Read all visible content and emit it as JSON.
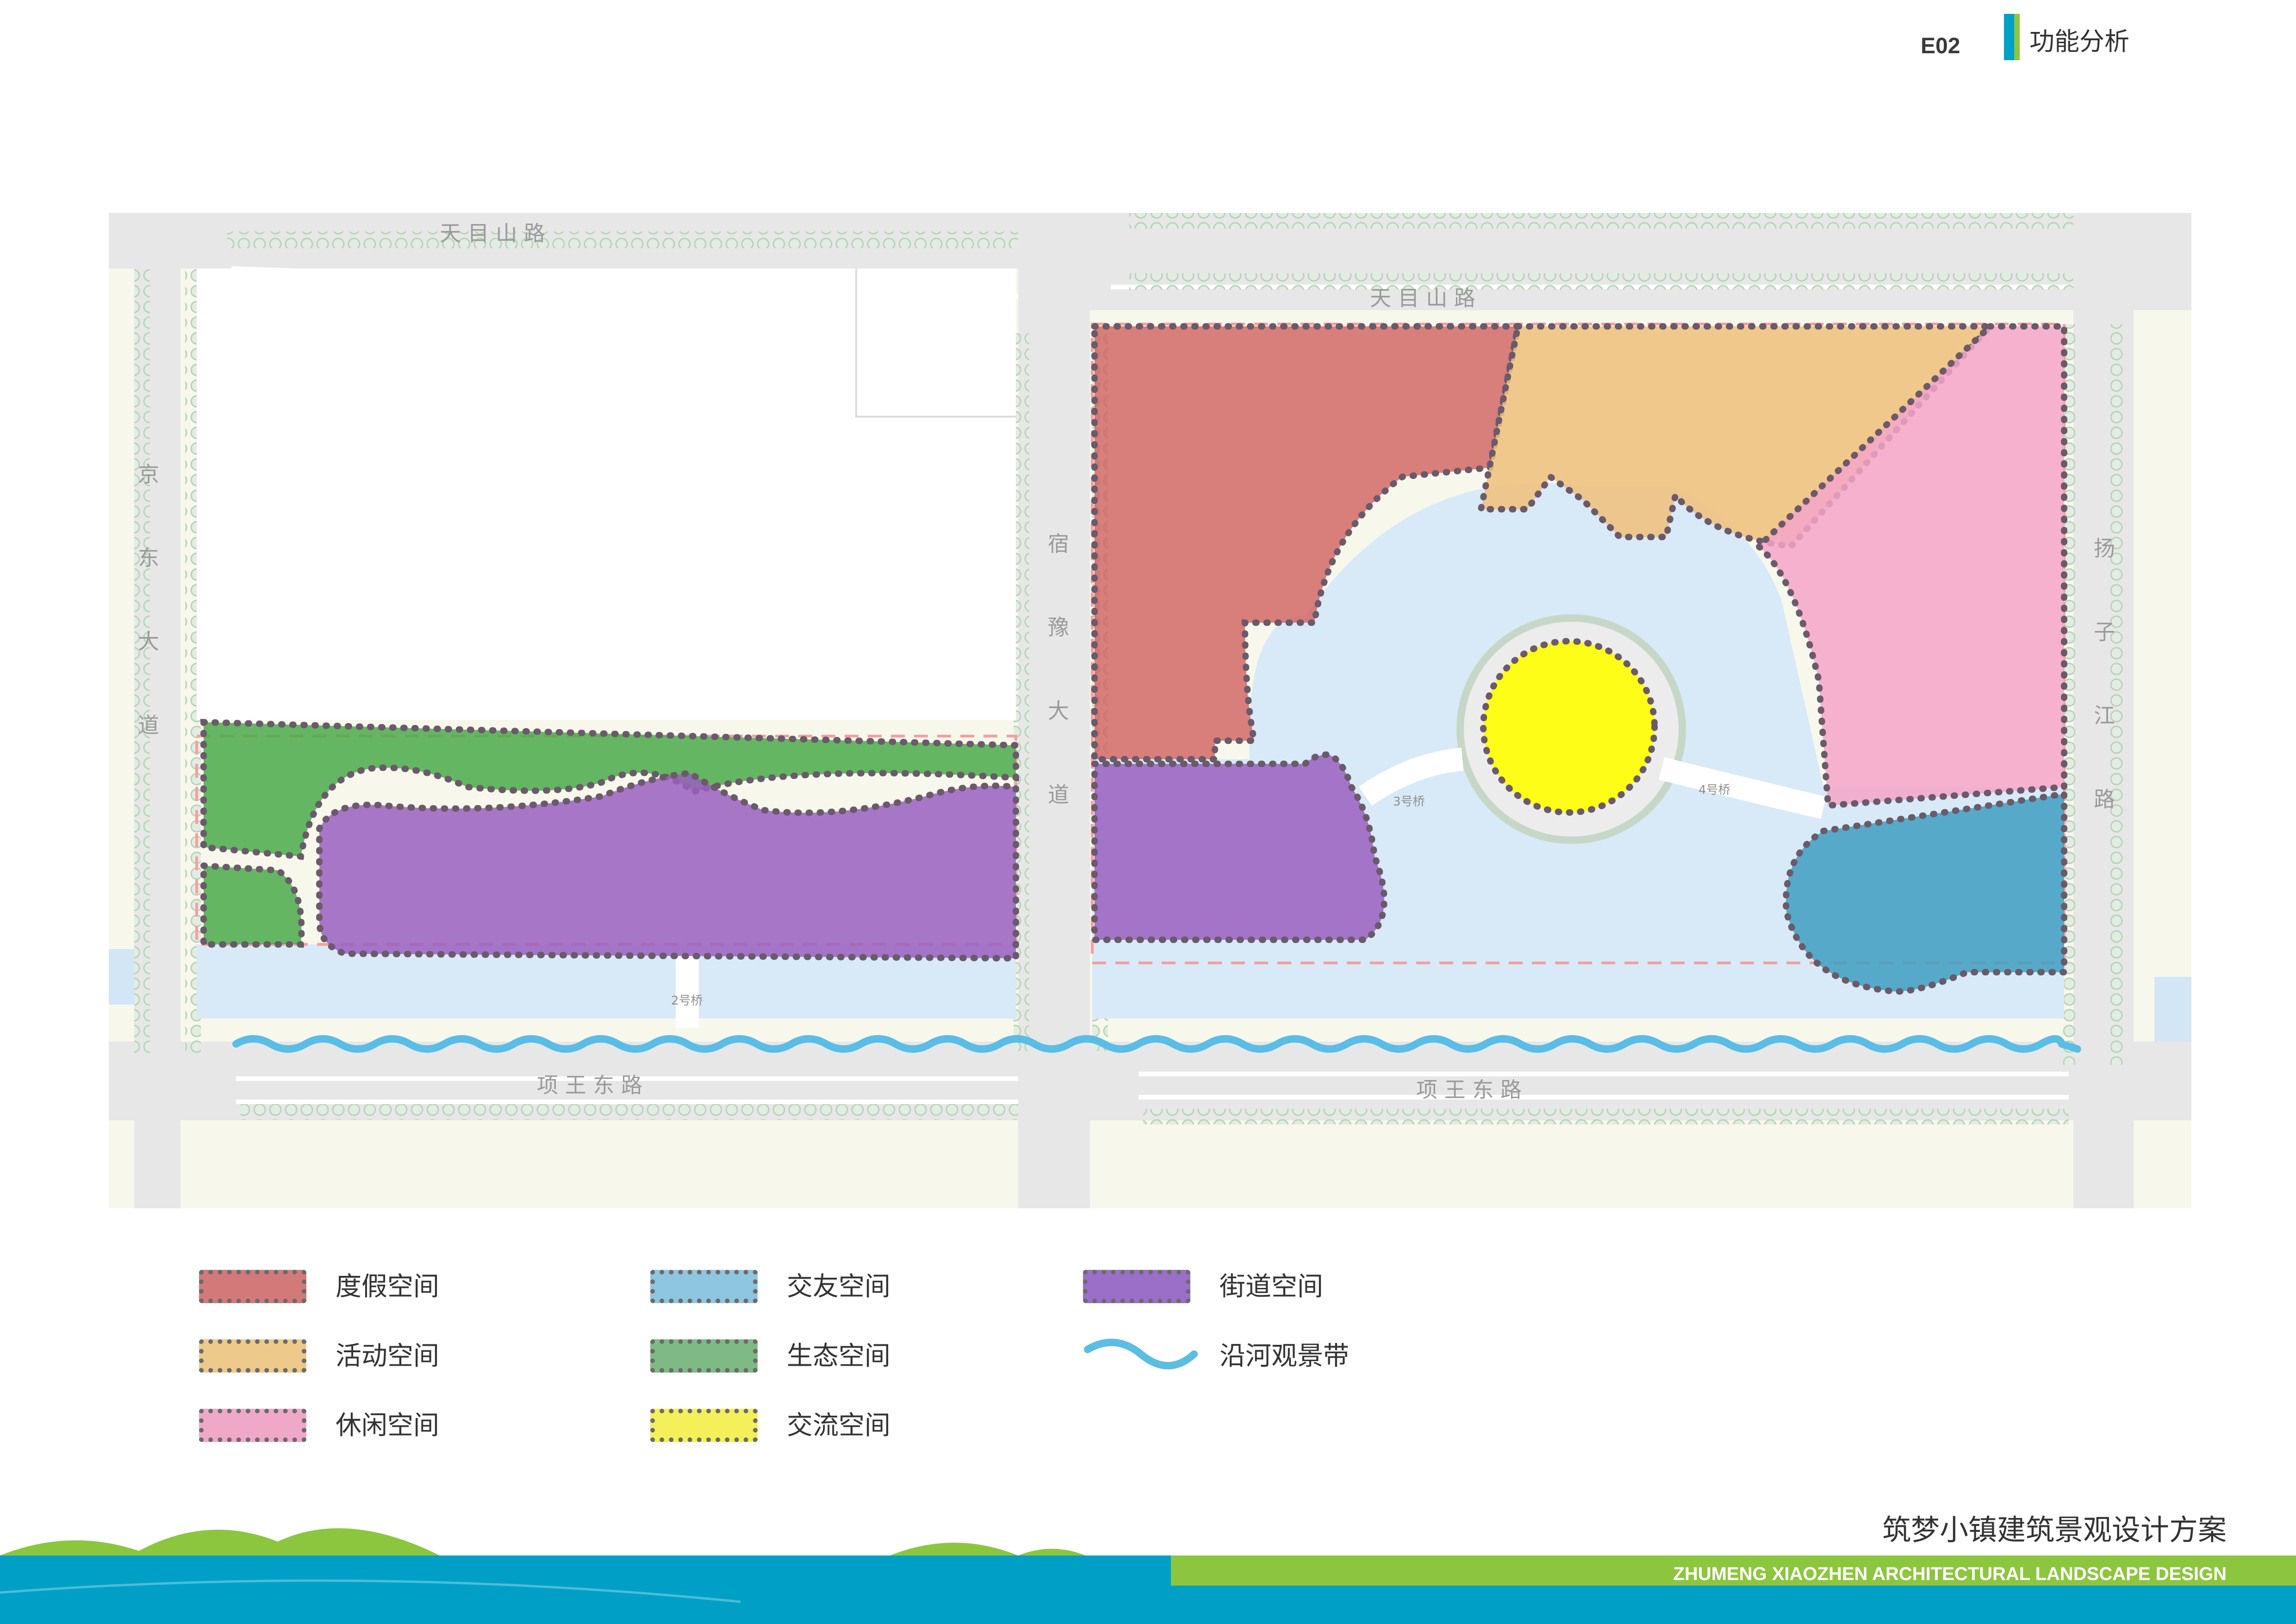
{
  "header": {
    "code": "E02",
    "title": "功能分析"
  },
  "plan": {
    "road_labels": {
      "tianmu_left": "天 目 山 路",
      "tianmu_right": "天 目 山 路",
      "jingdong": "京 东 大 道",
      "suyu": "宿 豫 大 道",
      "yangzijiang": "扬 子 江 路",
      "xiangwang_left": "项 王 东 路",
      "xiangwang_right": "项 王 东 路"
    },
    "bridge_labels": {
      "bridge2": "2号桥",
      "bridge3": "3号桥",
      "bridge4": "4号桥"
    }
  },
  "legend": {
    "items": [
      {
        "label": "度假空间",
        "color": "#d4797a"
      },
      {
        "label": "活动空间",
        "color": "#edc98c"
      },
      {
        "label": "休闲空间",
        "color": "#f0a8c9"
      },
      {
        "label": "交友空间",
        "color": "#8ec5df"
      },
      {
        "label": "生态空间",
        "color": "#7fba86"
      },
      {
        "label": "交流空间",
        "color": "#f4f05a"
      },
      {
        "label": "街道空间",
        "color": "#9b6fc8"
      }
    ],
    "riverside_label": "沿河观景带",
    "riverside_color": "#5cbde3"
  },
  "footer": {
    "title_cn": "筑梦小镇建筑景观设计方案",
    "title_en": "ZHUMENG XIAOZHEN ARCHITECTURAL LANDSCAPE DESIGN"
  },
  "colors": {
    "accent_green": "#8cc63f",
    "accent_blue": "#00a0c6",
    "zone_resort": "#cf5f5f",
    "zone_activity": "#f0c07a",
    "zone_leisure": "#f5a5c8",
    "zone_social": "#3f9ec0",
    "zone_ecology": "#4aaa4a",
    "zone_exchange": "#ffff00",
    "zone_street": "#9a5fc0",
    "water": "#d8e9f8",
    "riverside": "#59bde6"
  }
}
